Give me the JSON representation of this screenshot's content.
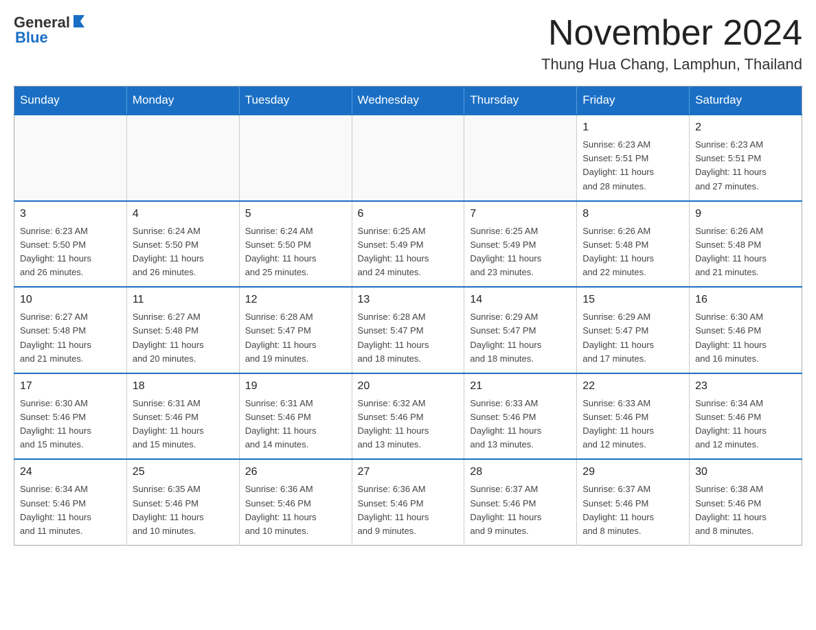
{
  "header": {
    "logo": {
      "general": "General",
      "blue": "Blue"
    },
    "month": "November 2024",
    "location": "Thung Hua Chang, Lamphun, Thailand"
  },
  "calendar": {
    "days_of_week": [
      "Sunday",
      "Monday",
      "Tuesday",
      "Wednesday",
      "Thursday",
      "Friday",
      "Saturday"
    ],
    "weeks": [
      [
        {
          "day": "",
          "info": ""
        },
        {
          "day": "",
          "info": ""
        },
        {
          "day": "",
          "info": ""
        },
        {
          "day": "",
          "info": ""
        },
        {
          "day": "",
          "info": ""
        },
        {
          "day": "1",
          "info": "Sunrise: 6:23 AM\nSunset: 5:51 PM\nDaylight: 11 hours\nand 28 minutes."
        },
        {
          "day": "2",
          "info": "Sunrise: 6:23 AM\nSunset: 5:51 PM\nDaylight: 11 hours\nand 27 minutes."
        }
      ],
      [
        {
          "day": "3",
          "info": "Sunrise: 6:23 AM\nSunset: 5:50 PM\nDaylight: 11 hours\nand 26 minutes."
        },
        {
          "day": "4",
          "info": "Sunrise: 6:24 AM\nSunset: 5:50 PM\nDaylight: 11 hours\nand 26 minutes."
        },
        {
          "day": "5",
          "info": "Sunrise: 6:24 AM\nSunset: 5:50 PM\nDaylight: 11 hours\nand 25 minutes."
        },
        {
          "day": "6",
          "info": "Sunrise: 6:25 AM\nSunset: 5:49 PM\nDaylight: 11 hours\nand 24 minutes."
        },
        {
          "day": "7",
          "info": "Sunrise: 6:25 AM\nSunset: 5:49 PM\nDaylight: 11 hours\nand 23 minutes."
        },
        {
          "day": "8",
          "info": "Sunrise: 6:26 AM\nSunset: 5:48 PM\nDaylight: 11 hours\nand 22 minutes."
        },
        {
          "day": "9",
          "info": "Sunrise: 6:26 AM\nSunset: 5:48 PM\nDaylight: 11 hours\nand 21 minutes."
        }
      ],
      [
        {
          "day": "10",
          "info": "Sunrise: 6:27 AM\nSunset: 5:48 PM\nDaylight: 11 hours\nand 21 minutes."
        },
        {
          "day": "11",
          "info": "Sunrise: 6:27 AM\nSunset: 5:48 PM\nDaylight: 11 hours\nand 20 minutes."
        },
        {
          "day": "12",
          "info": "Sunrise: 6:28 AM\nSunset: 5:47 PM\nDaylight: 11 hours\nand 19 minutes."
        },
        {
          "day": "13",
          "info": "Sunrise: 6:28 AM\nSunset: 5:47 PM\nDaylight: 11 hours\nand 18 minutes."
        },
        {
          "day": "14",
          "info": "Sunrise: 6:29 AM\nSunset: 5:47 PM\nDaylight: 11 hours\nand 18 minutes."
        },
        {
          "day": "15",
          "info": "Sunrise: 6:29 AM\nSunset: 5:47 PM\nDaylight: 11 hours\nand 17 minutes."
        },
        {
          "day": "16",
          "info": "Sunrise: 6:30 AM\nSunset: 5:46 PM\nDaylight: 11 hours\nand 16 minutes."
        }
      ],
      [
        {
          "day": "17",
          "info": "Sunrise: 6:30 AM\nSunset: 5:46 PM\nDaylight: 11 hours\nand 15 minutes."
        },
        {
          "day": "18",
          "info": "Sunrise: 6:31 AM\nSunset: 5:46 PM\nDaylight: 11 hours\nand 15 minutes."
        },
        {
          "day": "19",
          "info": "Sunrise: 6:31 AM\nSunset: 5:46 PM\nDaylight: 11 hours\nand 14 minutes."
        },
        {
          "day": "20",
          "info": "Sunrise: 6:32 AM\nSunset: 5:46 PM\nDaylight: 11 hours\nand 13 minutes."
        },
        {
          "day": "21",
          "info": "Sunrise: 6:33 AM\nSunset: 5:46 PM\nDaylight: 11 hours\nand 13 minutes."
        },
        {
          "day": "22",
          "info": "Sunrise: 6:33 AM\nSunset: 5:46 PM\nDaylight: 11 hours\nand 12 minutes."
        },
        {
          "day": "23",
          "info": "Sunrise: 6:34 AM\nSunset: 5:46 PM\nDaylight: 11 hours\nand 12 minutes."
        }
      ],
      [
        {
          "day": "24",
          "info": "Sunrise: 6:34 AM\nSunset: 5:46 PM\nDaylight: 11 hours\nand 11 minutes."
        },
        {
          "day": "25",
          "info": "Sunrise: 6:35 AM\nSunset: 5:46 PM\nDaylight: 11 hours\nand 10 minutes."
        },
        {
          "day": "26",
          "info": "Sunrise: 6:36 AM\nSunset: 5:46 PM\nDaylight: 11 hours\nand 10 minutes."
        },
        {
          "day": "27",
          "info": "Sunrise: 6:36 AM\nSunset: 5:46 PM\nDaylight: 11 hours\nand 9 minutes."
        },
        {
          "day": "28",
          "info": "Sunrise: 6:37 AM\nSunset: 5:46 PM\nDaylight: 11 hours\nand 9 minutes."
        },
        {
          "day": "29",
          "info": "Sunrise: 6:37 AM\nSunset: 5:46 PM\nDaylight: 11 hours\nand 8 minutes."
        },
        {
          "day": "30",
          "info": "Sunrise: 6:38 AM\nSunset: 5:46 PM\nDaylight: 11 hours\nand 8 minutes."
        }
      ]
    ]
  }
}
